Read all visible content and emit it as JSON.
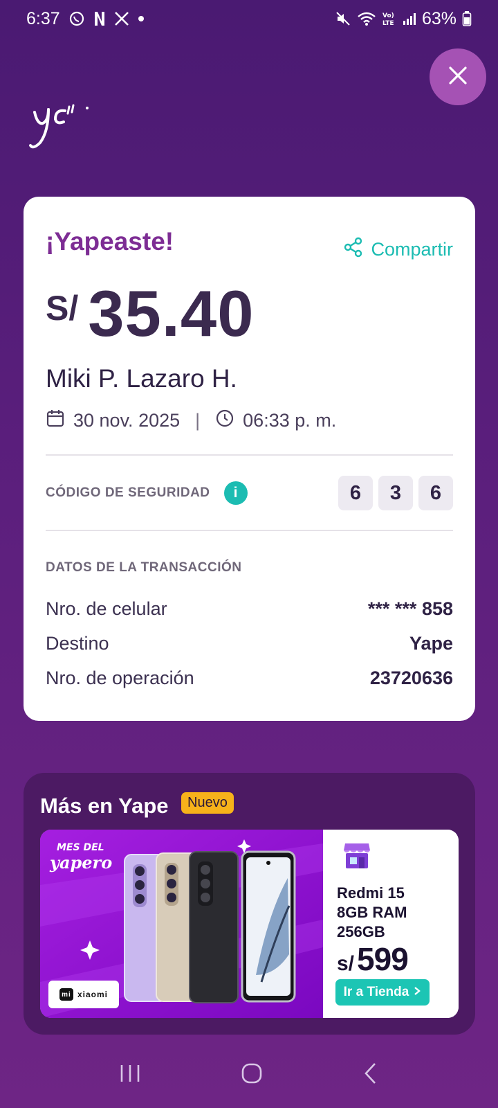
{
  "status_bar": {
    "time": "6:37",
    "battery": "63%",
    "icons": [
      "whatsapp-icon",
      "netflix-icon",
      "x-icon",
      "dot-icon",
      "mute-icon",
      "wifi-icon",
      "volte-icon",
      "signal-icon",
      "battery-icon"
    ]
  },
  "header": {
    "close_icon": "close-icon",
    "logo": "yape-logo"
  },
  "receipt": {
    "title": "¡Yapeaste!",
    "share_label": "Compartir",
    "currency": "S/",
    "amount": "35.40",
    "recipient": "Miki P. Lazaro H.",
    "date": "30 nov. 2025",
    "separator": "|",
    "time": "06:33 p. m.",
    "security_label": "CÓDIGO DE SEGURIDAD",
    "info_glyph": "i",
    "security_digits": [
      "6",
      "3",
      "6"
    ],
    "transaction_title": "DATOS DE LA TRANSACCIÓN",
    "rows": [
      {
        "label": "Nro. de celular",
        "value": "*** *** 858"
      },
      {
        "label": "Destino",
        "value": "Yape"
      },
      {
        "label": "Nro. de operación",
        "value": "23720636"
      }
    ]
  },
  "promo": {
    "title": "Más en Yape",
    "badge": "Nuevo",
    "banner_tag": "MES DEL yapero",
    "brand": "xiaomi",
    "brand_mark": "mi",
    "product_lines": [
      "Redmi 15",
      "8GB RAM",
      "256GB"
    ],
    "price_currency": "s/",
    "price": "599",
    "cta": "Ir a Tienda",
    "colors": {
      "banner": "#8c0ed0",
      "cta": "#1cc5b4",
      "badge": "#f7b21a"
    }
  },
  "nav": {
    "items": [
      "recents-icon",
      "home-icon",
      "back-icon"
    ]
  }
}
